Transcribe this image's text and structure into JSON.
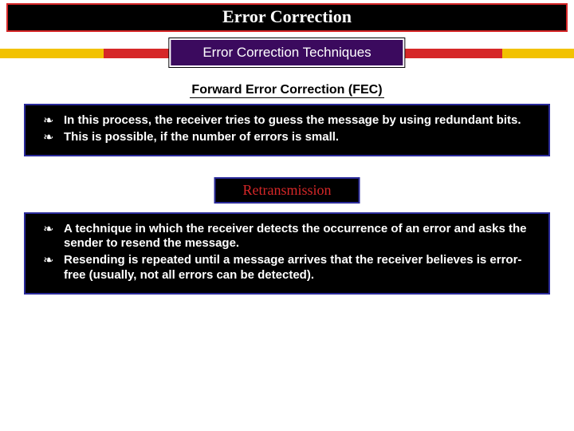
{
  "title": "Error Correction",
  "subtitle": "Error Correction Techniques",
  "section1": {
    "heading": "Forward Error Correction (FEC)",
    "bullets": [
      "In this process, the receiver tries to guess the message by using redundant bits.",
      "This is possible, if the number of errors is small."
    ]
  },
  "section2": {
    "heading": "Retransmission",
    "bullets": [
      "A technique in which the receiver detects the occurrence of an error and asks the sender to resend the message.",
      "Resending is repeated until a message arrives that the receiver believes is error-free (usually, not all errors can be detected)."
    ]
  }
}
